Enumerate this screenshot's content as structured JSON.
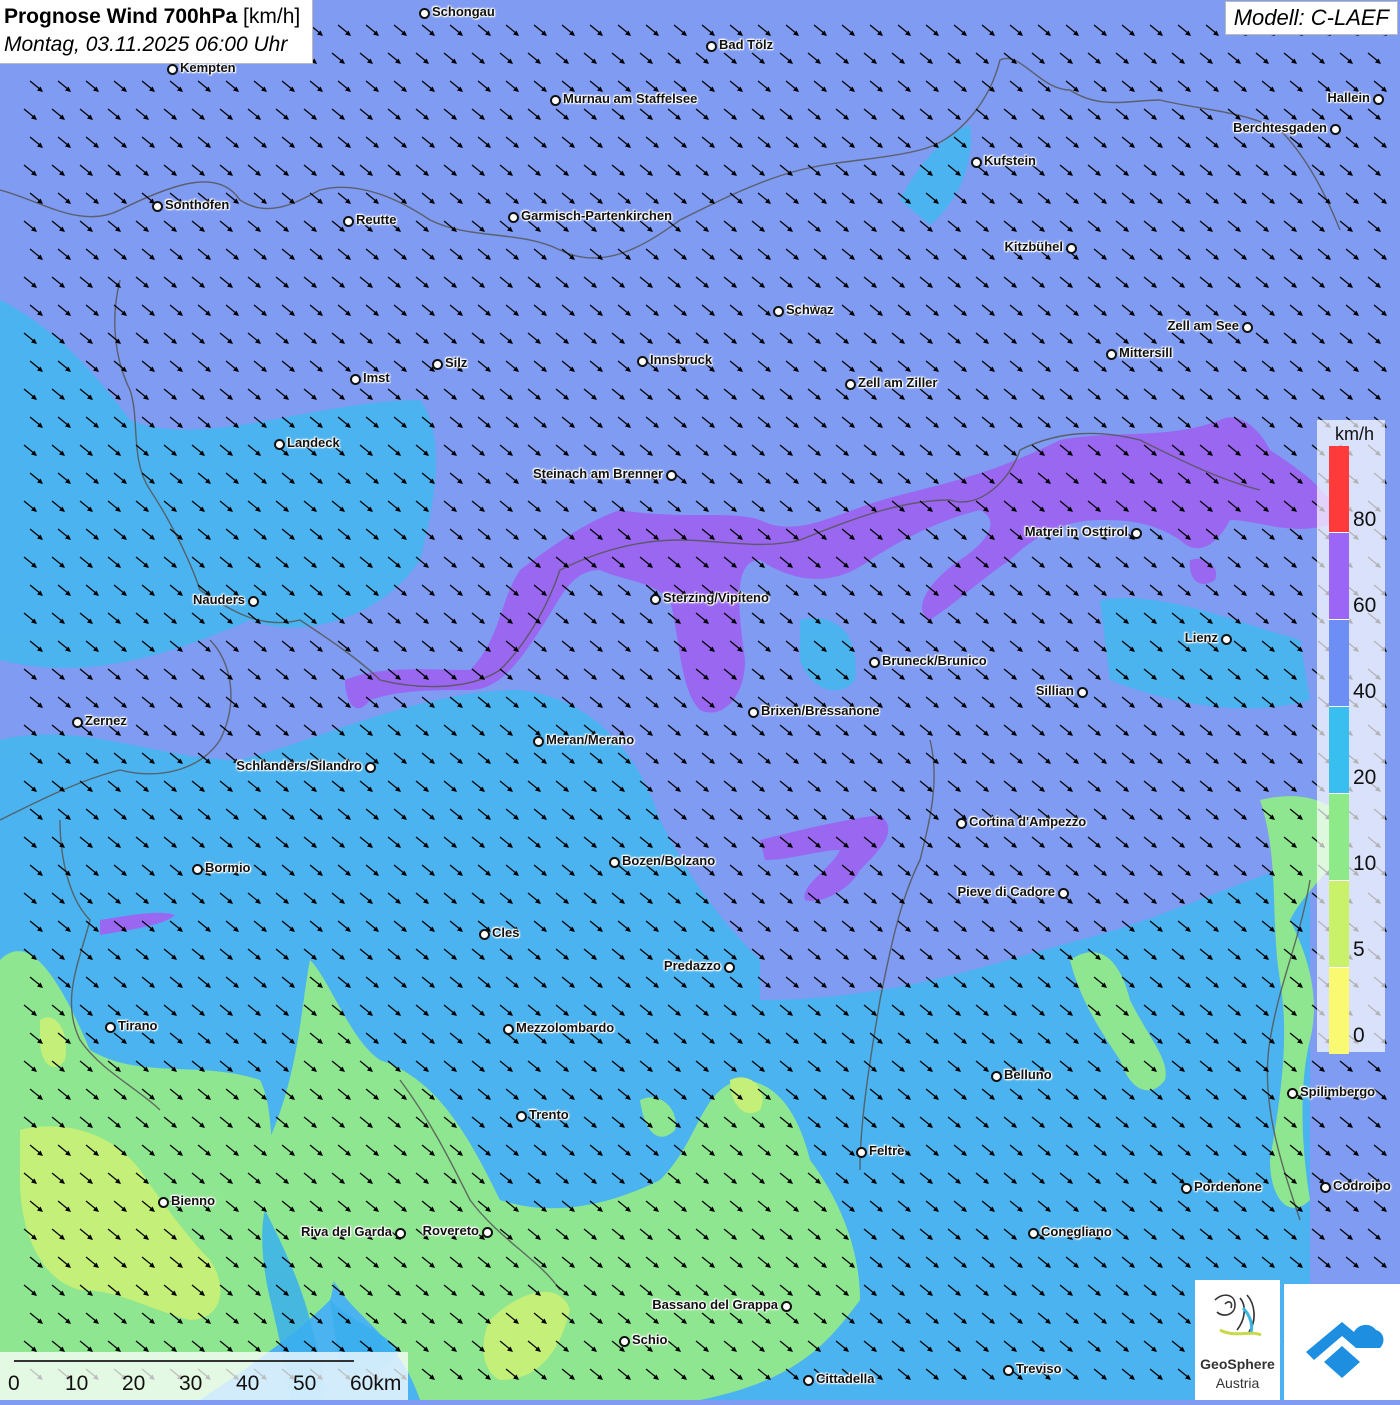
{
  "header": {
    "title_bold": "Prognose Wind 700hPa",
    "title_unit": "[km/h]",
    "subtitle": "Montag, 03.11.2025 06:00 Uhr",
    "model": "Modell: C-LAEF"
  },
  "legend": {
    "unit": "km/h",
    "labels": [
      "80",
      "60",
      "40",
      "20",
      "10",
      "5",
      "0"
    ],
    "colors": [
      "#ff3a3a",
      "#9b66f5",
      "#6d8ff5",
      "#38bff0",
      "#8eea88",
      "#c9f26a",
      "#fafa72"
    ]
  },
  "wind": {
    "direction": "northwest-to-southeast",
    "arrow_color": "#000000"
  },
  "scale": {
    "labels": [
      "0",
      "10",
      "20",
      "30",
      "40",
      "50",
      "60km"
    ]
  },
  "logos": {
    "geosphere_line1": "GeoSphere",
    "geosphere_line2": "Austria",
    "icon": "cloud-arrow-logo-icon"
  },
  "cities": [
    {
      "name": "Schongau"
    },
    {
      "name": "Bad Tölz"
    },
    {
      "name": "Kempten"
    },
    {
      "name": "Murnau am Staffelsee"
    },
    {
      "name": "Hallein"
    },
    {
      "name": "Berchtesgaden"
    },
    {
      "name": "Kufstein"
    },
    {
      "name": "Sonthofen"
    },
    {
      "name": "Reutte"
    },
    {
      "name": "Garmisch-Partenkirchen"
    },
    {
      "name": "Kitzbühel"
    },
    {
      "name": "Schwaz"
    },
    {
      "name": "Zell am See"
    },
    {
      "name": "Mittersill"
    },
    {
      "name": "Silz"
    },
    {
      "name": "Innsbruck"
    },
    {
      "name": "Imst"
    },
    {
      "name": "Zell am Ziller"
    },
    {
      "name": "Landeck"
    },
    {
      "name": "Steinach am Brenner"
    },
    {
      "name": "Matrei in Osttirol"
    },
    {
      "name": "Nauders"
    },
    {
      "name": "Sterzing/Vipiteno"
    },
    {
      "name": "Lienz"
    },
    {
      "name": "Bruneck/Brunico"
    },
    {
      "name": "Sillian"
    },
    {
      "name": "Zernez"
    },
    {
      "name": "Brixen/Bressanone"
    },
    {
      "name": "Meran/Merano"
    },
    {
      "name": "Schlanders/Silandro"
    },
    {
      "name": "Cortina d'Ampezzo"
    },
    {
      "name": "Bozen/Bolzano"
    },
    {
      "name": "Bormio"
    },
    {
      "name": "Pieve di Cadore"
    },
    {
      "name": "Cles"
    },
    {
      "name": "Predazzo"
    },
    {
      "name": "Tirano"
    },
    {
      "name": "Mezzolombardo"
    },
    {
      "name": "Belluno"
    },
    {
      "name": "Spilimbergo"
    },
    {
      "name": "Trento"
    },
    {
      "name": "Feltre"
    },
    {
      "name": "Bienno"
    },
    {
      "name": "Pordenone"
    },
    {
      "name": "Codroipo"
    },
    {
      "name": "Riva del Garda"
    },
    {
      "name": "Rovereto"
    },
    {
      "name": "Conegliano"
    },
    {
      "name": "Bassano del Grappa"
    },
    {
      "name": "Schio"
    },
    {
      "name": "Treviso"
    },
    {
      "name": "Cittadella"
    }
  ]
}
